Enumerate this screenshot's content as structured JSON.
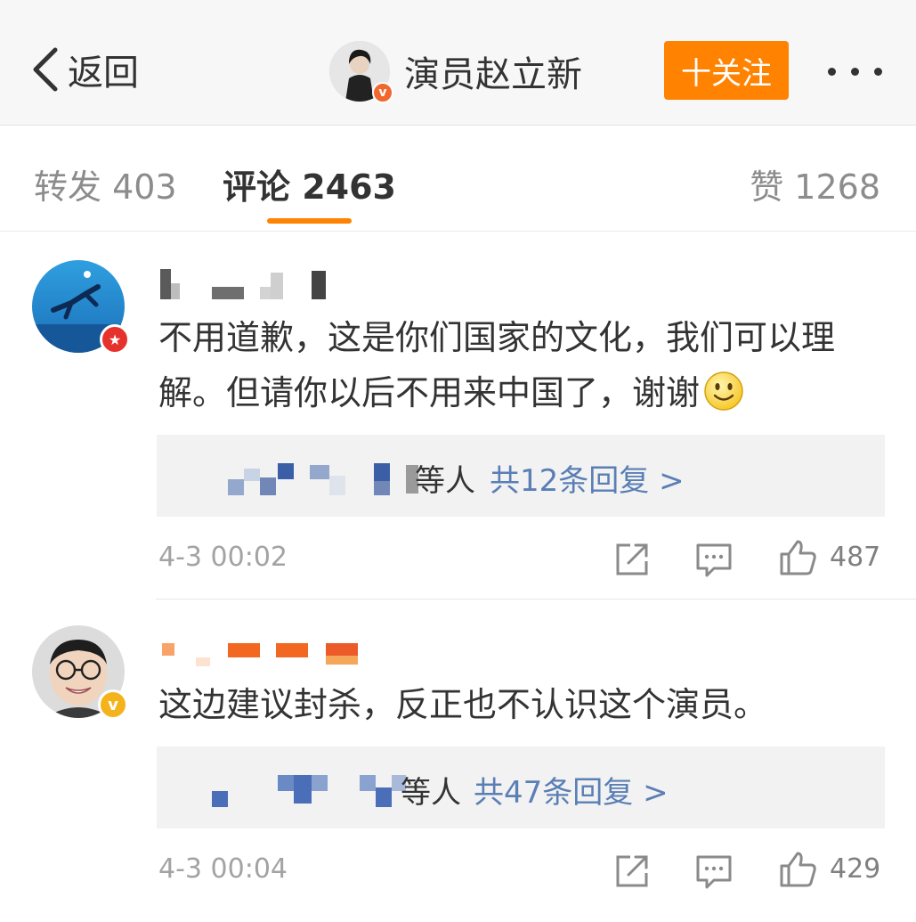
{
  "topbar": {
    "back_label": "返回",
    "account_name": "演员赵立新",
    "verified_mark": "v",
    "follow_label": "十关注",
    "more_icon": "more-dots-icon"
  },
  "tabs": {
    "repost": "转发 403",
    "comment": "评论 2463",
    "like": "赞 1268",
    "active_color": "#ff8200"
  },
  "comments": [
    {
      "text": "不用道歉，这是你们国家的文化，我们可以理解。但请你以后不用来中国了，谢谢",
      "emoji": "smiley-emoji-icon",
      "badge": "red-star-badge",
      "reply_suffix": "等人",
      "reply_count": "共12条回复 >",
      "time": "4-3 00:02",
      "likes": "487"
    },
    {
      "text": "这边建议封杀，反正也不认识这个演员。",
      "badge": "v",
      "reply_suffix": "等人",
      "reply_count": "共47条回复 >",
      "time": "4-3 00:04",
      "likes": "429"
    }
  ],
  "colors": {
    "accent": "#ff8200",
    "link": "#5a7fb5",
    "muted": "#a3a3a3"
  }
}
